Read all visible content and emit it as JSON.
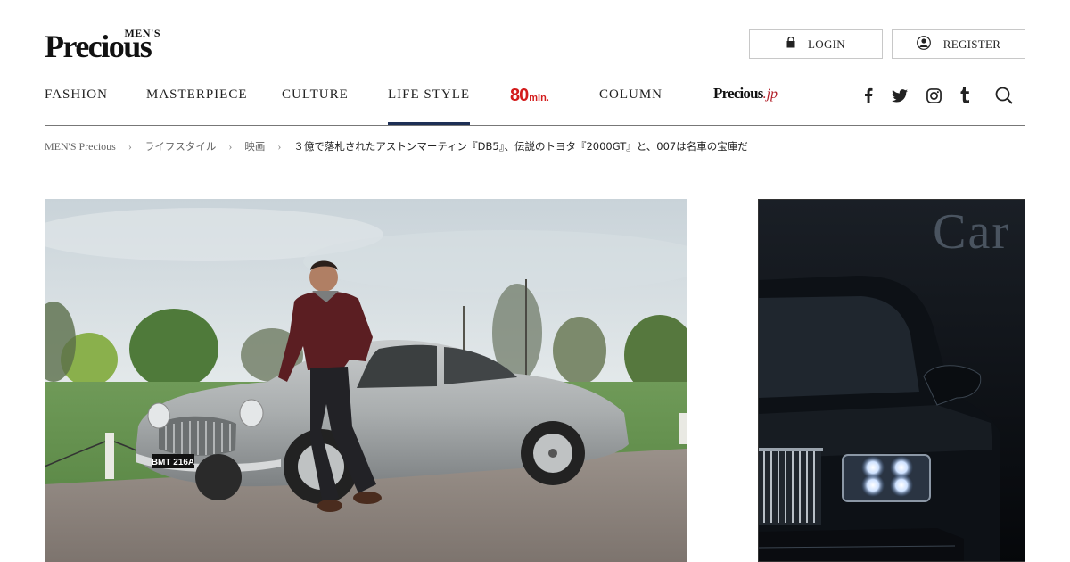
{
  "header": {
    "logo_small": "MEN'S",
    "logo_big": "Precious",
    "login_label": "LOGIN",
    "register_label": "REGISTER",
    "login_icon": "lock-icon",
    "register_icon": "user-icon"
  },
  "nav": {
    "items": [
      "FASHION",
      "MASTERPIECE",
      "CULTURE",
      "LIFE STYLE",
      "COLUMN"
    ],
    "active": "LIFE STYLE",
    "min80_number": "80",
    "min80_unit": "min.",
    "precious_jp_main": "Precious",
    "precious_jp_sub": ".jp",
    "social_icons": [
      "facebook-icon",
      "twitter-icon",
      "instagram-icon",
      "tumblr-icon",
      "search-icon"
    ]
  },
  "breadcrumb": {
    "items": [
      "MEN'S Precious",
      "ライフスタイル",
      "映画"
    ],
    "current": "３億で落札されたアストンマーティン『DB5』、伝説のトヨタ『2000GT』と、007は名車の宝庫だ"
  },
  "hero": {
    "plate_text": "BMT 216A"
  },
  "ad": {
    "title": "Car"
  },
  "colors": {
    "accent_navy": "#1d2f55",
    "red_80min": "#d31c1c",
    "precious_jp_red": "#b3202a"
  }
}
